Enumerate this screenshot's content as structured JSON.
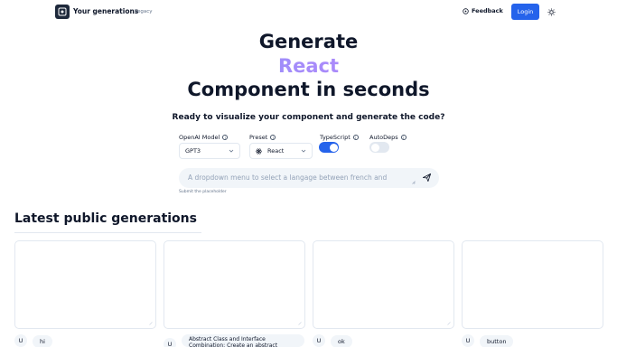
{
  "header": {
    "title": "Your generations",
    "legacy": "Legacy",
    "feedback": "Feedback",
    "login": "Login"
  },
  "hero": {
    "line1": "Generate",
    "line2": "React",
    "line3": "Component in seconds",
    "subtitle": "Ready to visualize your component and generate the code?"
  },
  "controls": {
    "model_label": "OpenAI Model",
    "model_value": "GPT3",
    "preset_label": "Preset",
    "preset_value": "React",
    "typescript_label": "TypeScript",
    "typescript_on": true,
    "autodeps_label": "AutoDeps",
    "autodeps_on": false
  },
  "prompt": {
    "value": "A dropdown menu to select a langage between french and",
    "hint": "Submit the placeholder"
  },
  "latest": {
    "title": "Latest public generations",
    "cards": [
      {
        "avatar": "U",
        "label": "hi"
      },
      {
        "avatar": "U",
        "label": "Abstract Class and Interface Combination: Create an abstract"
      },
      {
        "avatar": "U",
        "label": "ok"
      },
      {
        "avatar": "U",
        "label": "button"
      }
    ]
  },
  "colors": {
    "accent": "#2563eb",
    "gradient_start": "#60a5fa",
    "gradient_end": "#c084fc"
  }
}
